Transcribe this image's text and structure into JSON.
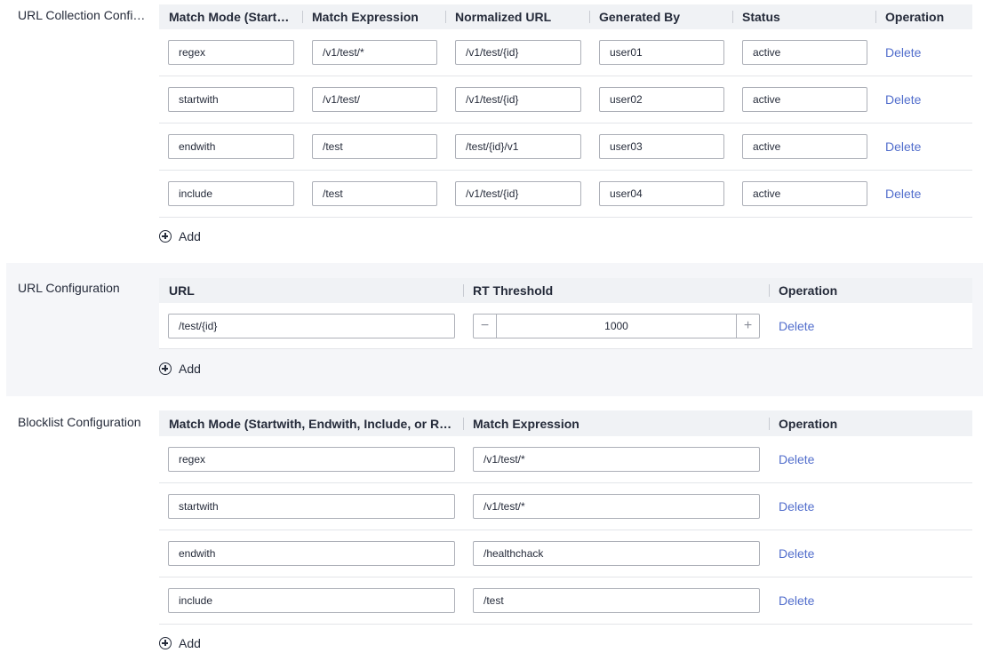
{
  "url_collection": {
    "label": "URL Collection Confi…",
    "headers": [
      "Match Mode (Start…",
      "Match Expression",
      "Normalized URL",
      "Generated By",
      "Status",
      "Operation"
    ],
    "rows": [
      {
        "mode": "regex",
        "expr": "/v1/test/*",
        "normalized": "/v1/test/{id}",
        "by": "user01",
        "status": "active",
        "op": "Delete"
      },
      {
        "mode": "startwith",
        "expr": "/v1/test/",
        "normalized": "/v1/test/{id}",
        "by": "user02",
        "status": "active",
        "op": "Delete"
      },
      {
        "mode": "endwith",
        "expr": "/test",
        "normalized": "/test/{id}/v1",
        "by": "user03",
        "status": "active",
        "op": "Delete"
      },
      {
        "mode": "include",
        "expr": "/test",
        "normalized": "/v1/test/{id}",
        "by": "user04",
        "status": "active",
        "op": "Delete"
      }
    ],
    "add_label": "Add"
  },
  "url_config": {
    "label": "URL Configuration",
    "headers": [
      "URL",
      "RT Threshold",
      "Operation"
    ],
    "rows": [
      {
        "url": "/test/{id}",
        "threshold": "1000",
        "minus": "−",
        "plus": "+",
        "op": "Delete"
      }
    ],
    "add_label": "Add"
  },
  "blocklist": {
    "label": "Blocklist Configuration",
    "headers": [
      "Match Mode (Startwith, Endwith, Include, or R…",
      "Match Expression",
      "Operation"
    ],
    "rows": [
      {
        "mode": "regex",
        "expr": "/v1/test/*",
        "op": "Delete"
      },
      {
        "mode": "startwith",
        "expr": "/v1/test/*",
        "op": "Delete"
      },
      {
        "mode": "endwith",
        "expr": "/healthchack",
        "op": "Delete"
      },
      {
        "mode": "include",
        "expr": "/test",
        "op": "Delete"
      }
    ],
    "add_label": "Add"
  }
}
